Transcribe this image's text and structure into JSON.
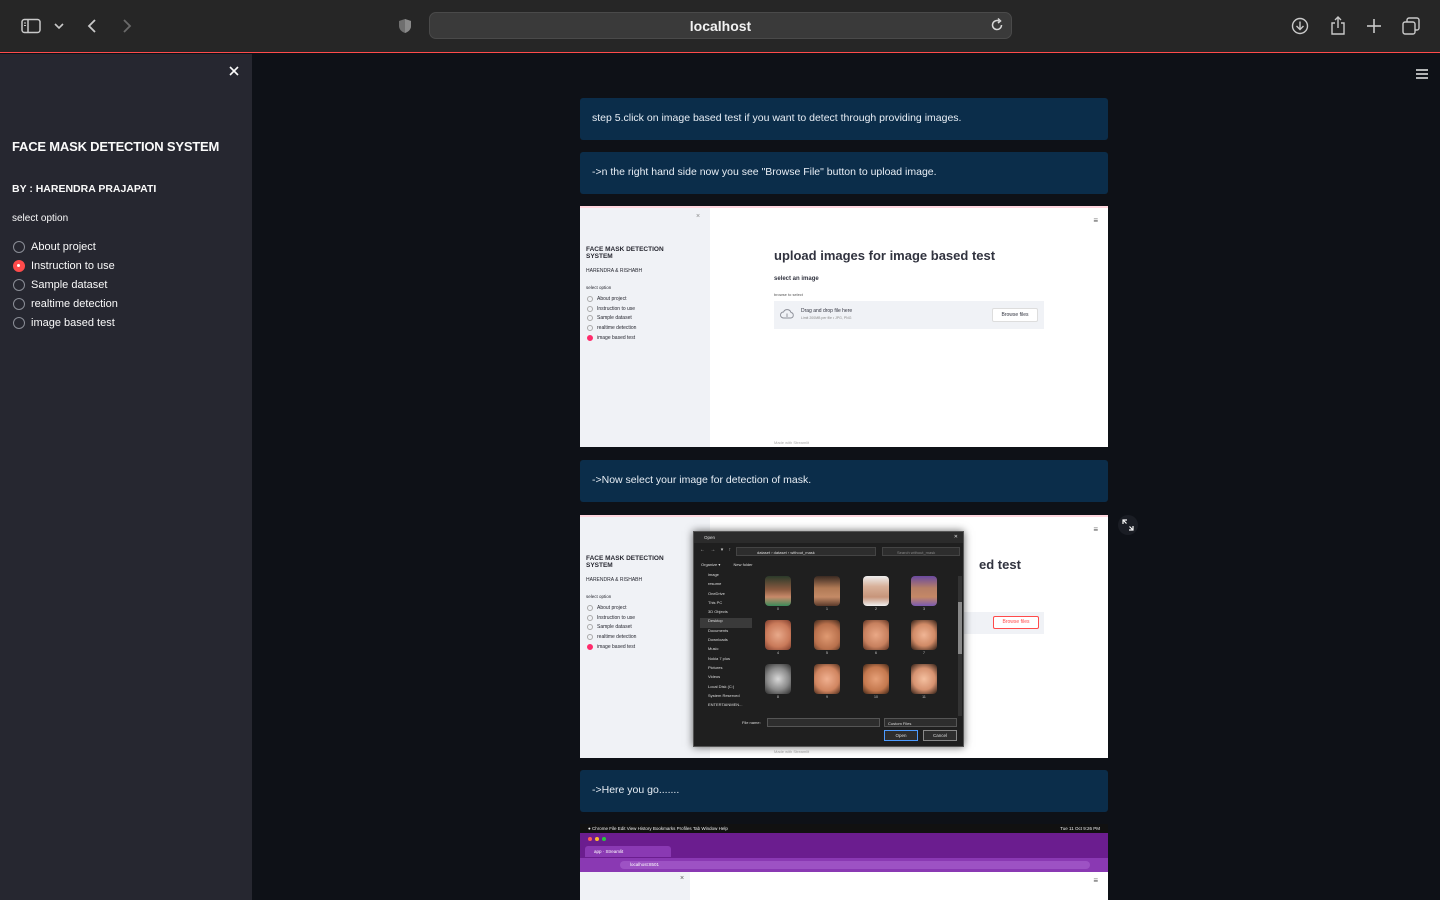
{
  "browser": {
    "url": "localhost"
  },
  "sidebar": {
    "title": "FACE MASK DETECTION SYSTEM",
    "author": "BY : HARENDRA PRAJAPATI",
    "select_label": "select option",
    "options": [
      {
        "label": "About project",
        "selected": false
      },
      {
        "label": "Instruction to use",
        "selected": true
      },
      {
        "label": "Sample dataset",
        "selected": false
      },
      {
        "label": "realtime detection",
        "selected": false
      },
      {
        "label": "image based test",
        "selected": false
      }
    ]
  },
  "main": {
    "info_boxes": [
      "step 5.click on image based test if you want to detect through providing images.",
      "->n the right hand side now you see \"Browse File\" button to upload image.",
      "->Now select your image for detection of mask.",
      "->Here you go......."
    ]
  },
  "screenshot1": {
    "sidebar_title": "FACE MASK DETECTION SYSTEM",
    "sidebar_by": "HARENDRA & RISHABH",
    "select_label": "select option",
    "options": [
      "About project",
      "Instruction to use",
      "Sample dataset",
      "realtime detection",
      "image based test"
    ],
    "heading": "upload images for image based test",
    "select_image_label": "select an image",
    "browse_label": "browse to select",
    "drop_text": "Drag and drop file here",
    "drop_limit": "Limit 200MB per file • JPG, PNG",
    "browse_button": "Browse files",
    "footer": "Made with Streamlit"
  },
  "screenshot2": {
    "sidebar_title": "FACE MASK DETECTION SYSTEM",
    "sidebar_by": "HARENDRA & RISHABH",
    "select_label": "select option",
    "options": [
      "About project",
      "Instruction to use",
      "Sample dataset",
      "realtime detection",
      "image based test"
    ],
    "heading_fragment": "ed test",
    "browse_button": "Browse files",
    "footer": "Made with Streamlit",
    "dialog": {
      "title": "Open",
      "path": "dataset › dataset › without_mask",
      "search_placeholder": "Search without_mask",
      "organize": "Organize ▾",
      "new_folder": "New folder",
      "nav_items": [
        "image",
        "resume",
        "OneDrive",
        "This PC",
        "3D Objects",
        "Desktop",
        "Documents",
        "Downloads",
        "Music",
        "Nokia 7 plus",
        "Pictures",
        "Videos",
        "Local Disk (C:)",
        "System Reserved",
        "ENTERTAINMEN..."
      ],
      "thumb_numbers": [
        "0",
        "1",
        "2",
        "3",
        "4",
        "5",
        "6",
        "7",
        "8",
        "9",
        "10",
        "11"
      ],
      "file_name_label": "File name:",
      "filter": "Custom Files",
      "open_button": "Open",
      "cancel_button": "Cancel"
    }
  },
  "screenshot3": {
    "menubar": "Chrome   File   Edit   View   History   Bookmarks   Profiles   Tab   Window   Help",
    "clock": "Tue 11 Oct  9:26 PM",
    "tab_title": "app · Streamlit",
    "url": "localhost:8501"
  },
  "colors": {
    "sidebar_bg": "#262730",
    "main_bg": "#0e1117",
    "info_bg": "#0b2d4a",
    "accent": "#ff4b4b"
  }
}
